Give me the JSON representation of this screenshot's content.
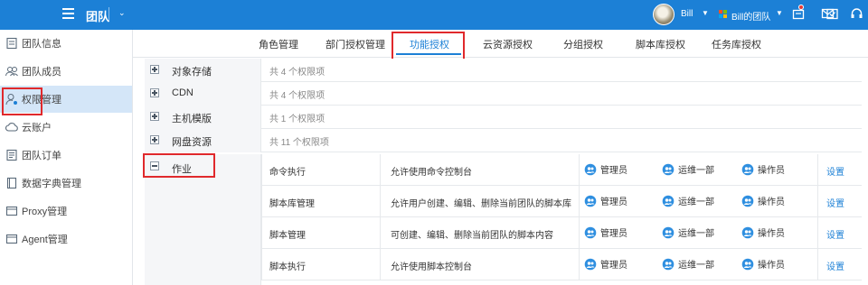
{
  "topbar": {
    "team_title": "团队",
    "user_name": "Bill",
    "team_switch": "Bill的团队",
    "colors": {
      "bar": "#1c80d6",
      "notification": "#e53935"
    },
    "icons": [
      "menu-icon",
      "avatar",
      "team-logo-icon",
      "alert-icon",
      "mail-icon",
      "task-icon",
      "headset-icon"
    ]
  },
  "sidebar": {
    "items": [
      {
        "label": "团队信息",
        "icon": "info-icon"
      },
      {
        "label": "团队成员",
        "icon": "members-icon"
      },
      {
        "label": "权限管理",
        "icon": "permission-icon",
        "active": true
      },
      {
        "label": "云账户",
        "icon": "cloud-icon"
      },
      {
        "label": "团队订单",
        "icon": "order-icon"
      },
      {
        "label": "数据字典管理",
        "icon": "dictionary-icon"
      },
      {
        "label": "Proxy管理",
        "icon": "proxy-icon"
      },
      {
        "label": "Agent管理",
        "icon": "agent-icon"
      }
    ]
  },
  "tabs": [
    {
      "label": "角色管理"
    },
    {
      "label": "部门授权管理"
    },
    {
      "label": "功能授权",
      "active": true
    },
    {
      "label": "云资源授权"
    },
    {
      "label": "分组授权"
    },
    {
      "label": "脚本库授权"
    },
    {
      "label": "任务库授权"
    }
  ],
  "groups": [
    {
      "name": "对象存储",
      "count": "共 4 个权限项",
      "expanded": false
    },
    {
      "name": "CDN",
      "count": "共 4 个权限项",
      "expanded": false
    },
    {
      "name": "主机模版",
      "count": "共 1 个权限项",
      "expanded": false
    },
    {
      "name": "网盘资源",
      "count": "共 11 个权限项",
      "expanded": false
    },
    {
      "name": "作业",
      "expanded": true
    }
  ],
  "job_permissions": [
    {
      "name": "命令执行",
      "desc": "允许使用命令控制台",
      "roles": [
        "管理员",
        "运维一部",
        "操作员"
      ],
      "action": "设置"
    },
    {
      "name": "脚本库管理",
      "desc": "允许用户创建、编辑、删除当前团队的脚本库",
      "roles": [
        "管理员",
        "运维一部",
        "操作员"
      ],
      "action": "设置"
    },
    {
      "name": "脚本管理",
      "desc": "可创建、编辑、删除当前团队的脚本内容",
      "roles": [
        "管理员",
        "运维一部",
        "操作员"
      ],
      "action": "设置"
    },
    {
      "name": "脚本执行",
      "desc": "允许使用脚本控制台",
      "roles": [
        "管理员",
        "运维一部",
        "操作员"
      ],
      "action": "设置"
    }
  ]
}
